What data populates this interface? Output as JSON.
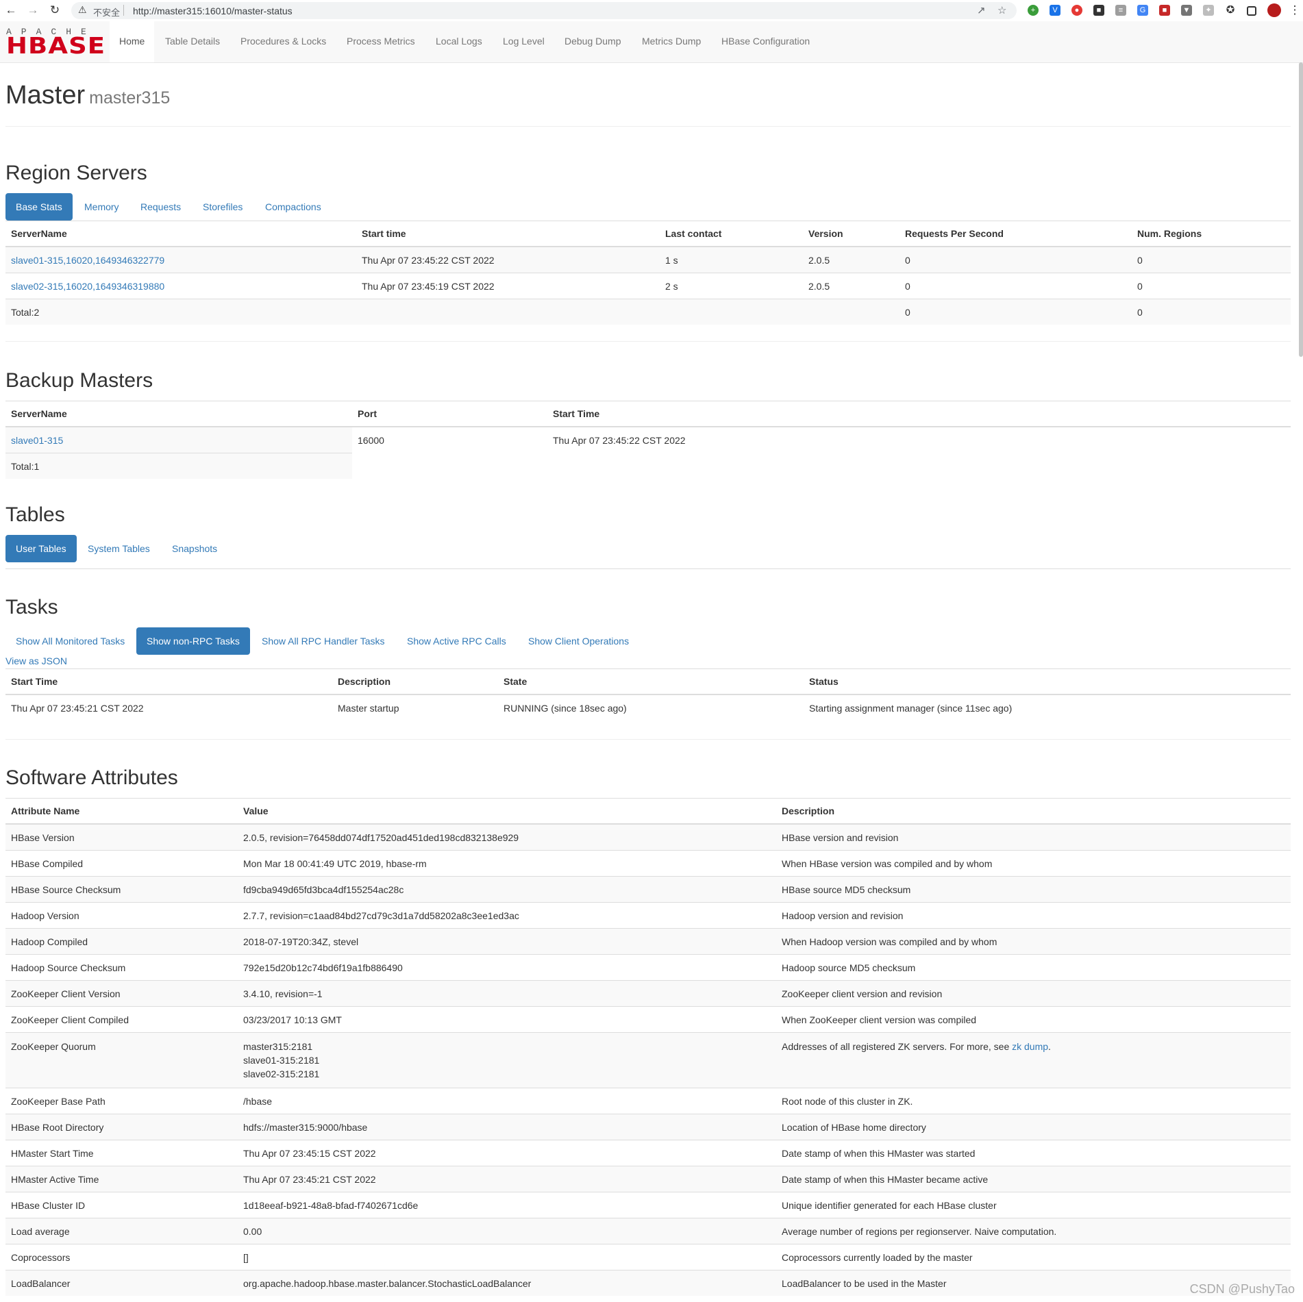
{
  "browser": {
    "insecure_label": "不安全",
    "url": "http://master315:16010/master-status"
  },
  "nav": {
    "logo_top": "APACHE",
    "logo_main": "HBASE",
    "items": [
      "Home",
      "Table Details",
      "Procedures & Locks",
      "Process Metrics",
      "Local Logs",
      "Log Level",
      "Debug Dump",
      "Metrics Dump",
      "HBase Configuration"
    ]
  },
  "page": {
    "title": "Master",
    "subtitle": "master315"
  },
  "region_servers": {
    "heading": "Region Servers",
    "tabs": [
      "Base Stats",
      "Memory",
      "Requests",
      "Storefiles",
      "Compactions"
    ],
    "columns": [
      "ServerName",
      "Start time",
      "Last contact",
      "Version",
      "Requests Per Second",
      "Num. Regions"
    ],
    "rows": [
      [
        "slave01-315,16020,1649346322779",
        "Thu Apr 07 23:45:22 CST 2022",
        "1 s",
        "2.0.5",
        "0",
        "0"
      ],
      [
        "slave02-315,16020,1649346319880",
        "Thu Apr 07 23:45:19 CST 2022",
        "2 s",
        "2.0.5",
        "0",
        "0"
      ]
    ],
    "total": [
      "Total:2",
      "0",
      "0"
    ]
  },
  "backup_masters": {
    "heading": "Backup Masters",
    "columns": [
      "ServerName",
      "Port",
      "Start Time"
    ],
    "rows": [
      [
        "slave01-315",
        "16000",
        "Thu Apr 07 23:45:22 CST 2022"
      ]
    ],
    "total": "Total:1"
  },
  "tables": {
    "heading": "Tables",
    "tabs": [
      "User Tables",
      "System Tables",
      "Snapshots"
    ]
  },
  "tasks": {
    "heading": "Tasks",
    "tabs": [
      "Show All Monitored Tasks",
      "Show non-RPC Tasks",
      "Show All RPC Handler Tasks",
      "Show Active RPC Calls",
      "Show Client Operations"
    ],
    "json_link": "View as JSON",
    "columns": [
      "Start Time",
      "Description",
      "State",
      "Status"
    ],
    "rows": [
      [
        "Thu Apr 07 23:45:21 CST 2022",
        "Master startup",
        "RUNNING (since 18sec ago)",
        "Starting assignment manager (since 11sec ago)"
      ]
    ]
  },
  "software": {
    "heading": "Software Attributes",
    "columns": [
      "Attribute Name",
      "Value",
      "Description"
    ],
    "rows": [
      [
        "HBase Version",
        "2.0.5, revision=76458dd074df17520ad451ded198cd832138e929",
        "HBase version and revision"
      ],
      [
        "HBase Compiled",
        "Mon Mar 18 00:41:49 UTC 2019, hbase-rm",
        "When HBase version was compiled and by whom"
      ],
      [
        "HBase Source Checksum",
        "fd9cba949d65fd3bca4df155254ac28c",
        "HBase source MD5 checksum"
      ],
      [
        "Hadoop Version",
        "2.7.7, revision=c1aad84bd27cd79c3d1a7dd58202a8c3ee1ed3ac",
        "Hadoop version and revision"
      ],
      [
        "Hadoop Compiled",
        "2018-07-19T20:34Z, stevel",
        "When Hadoop version was compiled and by whom"
      ],
      [
        "Hadoop Source Checksum",
        "792e15d20b12c74bd6f19a1fb886490",
        "Hadoop source MD5 checksum"
      ],
      [
        "ZooKeeper Client Version",
        "3.4.10, revision=-1",
        "ZooKeeper client version and revision"
      ],
      [
        "ZooKeeper Client Compiled",
        "03/23/2017 10:13 GMT",
        "When ZooKeeper client version was compiled"
      ]
    ],
    "quorum": {
      "name": "ZooKeeper Quorum",
      "values": [
        "master315:2181",
        "slave01-315:2181",
        "slave02-315:2181"
      ],
      "desc_prefix": "Addresses of all registered ZK servers. For more, see",
      "desc_link": "zk dump",
      "desc_suffix": "."
    },
    "rows2": [
      [
        "ZooKeeper Base Path",
        "/hbase",
        "Root node of this cluster in ZK."
      ],
      [
        "HBase Root Directory",
        "hdfs://master315:9000/hbase",
        "Location of HBase home directory"
      ],
      [
        "HMaster Start Time",
        "Thu Apr 07 23:45:15 CST 2022",
        "Date stamp of when this HMaster was started"
      ],
      [
        "HMaster Active Time",
        "Thu Apr 07 23:45:21 CST 2022",
        "Date stamp of when this HMaster became active"
      ],
      [
        "HBase Cluster ID",
        "1d18eeaf-b921-48a8-bfad-f7402671cd6e",
        "Unique identifier generated for each HBase cluster"
      ],
      [
        "Load average",
        "0.00",
        "Average number of regions per regionserver. Naive computation."
      ],
      [
        "Coprocessors",
        "[]",
        "Coprocessors currently loaded by the master"
      ],
      [
        "LoadBalancer",
        "org.apache.hadoop.hbase.master.balancer.StochasticLoadBalancer",
        "LoadBalancer to be used in the Master"
      ]
    ]
  },
  "watermark": "CSDN @PushyTao"
}
